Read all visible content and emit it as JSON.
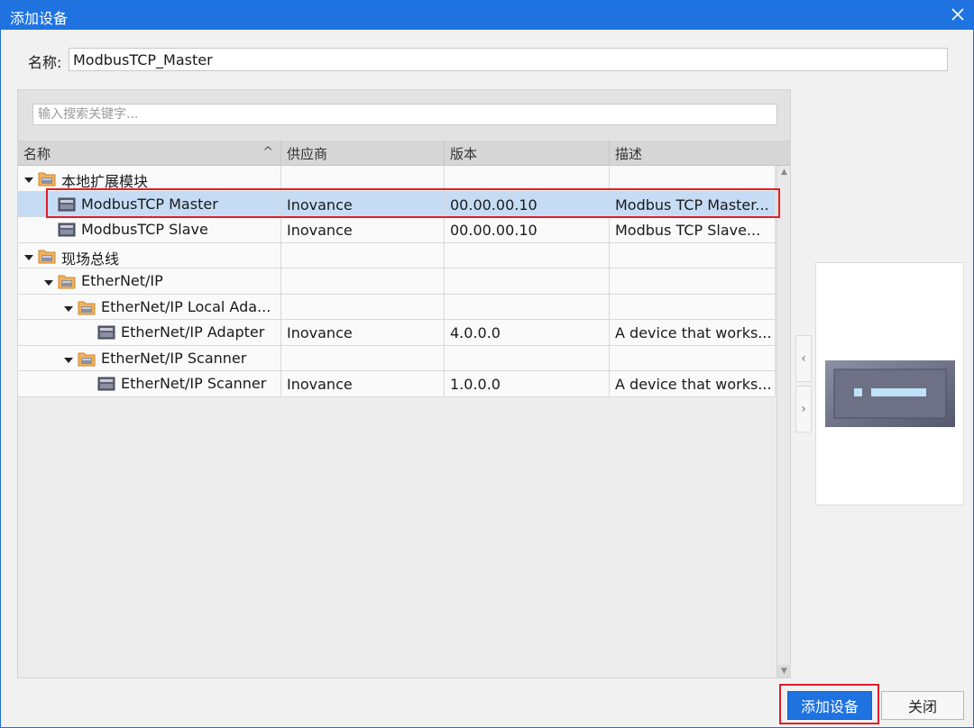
{
  "window": {
    "title": "添加设备"
  },
  "name_field": {
    "label": "名称:",
    "value": "ModbusTCP_Master"
  },
  "search": {
    "placeholder": "输入搜索关键字..."
  },
  "columns": [
    "名称",
    "供应商",
    "版本",
    "描述"
  ],
  "tree": [
    {
      "level": 0,
      "type": "folder",
      "expanded": true,
      "name": "本地扩展模块",
      "vendor": "",
      "version": "",
      "desc": ""
    },
    {
      "level": 1,
      "type": "device",
      "name": "ModbusTCP Master",
      "vendor": "Inovance",
      "version": "00.00.00.10",
      "desc": "Modbus TCP Master...",
      "selected": true
    },
    {
      "level": 1,
      "type": "device",
      "name": "ModbusTCP Slave",
      "vendor": "Inovance",
      "version": "00.00.00.10",
      "desc": "Modbus TCP Slave..."
    },
    {
      "level": 0,
      "type": "folder",
      "expanded": true,
      "name": "现场总线",
      "vendor": "",
      "version": "",
      "desc": ""
    },
    {
      "level": 1,
      "type": "folder",
      "expanded": true,
      "name": "EtherNet/IP",
      "vendor": "",
      "version": "",
      "desc": ""
    },
    {
      "level": 2,
      "type": "folder",
      "expanded": true,
      "name": "EtherNet/IP Local Ada...",
      "vendor": "",
      "version": "",
      "desc": ""
    },
    {
      "level": 3,
      "type": "device",
      "name": "EtherNet/IP Adapter",
      "vendor": "Inovance",
      "version": "4.0.0.0",
      "desc": "A device that works..."
    },
    {
      "level": 2,
      "type": "folder",
      "expanded": true,
      "name": "EtherNet/IP Scanner",
      "vendor": "",
      "version": "",
      "desc": ""
    },
    {
      "level": 3,
      "type": "device",
      "name": "EtherNet/IP Scanner",
      "vendor": "Inovance",
      "version": "1.0.0.0",
      "desc": "A device that works..."
    }
  ],
  "nav": {
    "prev": "‹",
    "next": "›"
  },
  "buttons": {
    "add": "添加设备",
    "close": "关闭"
  },
  "colors": {
    "accent": "#1f73e0",
    "selection": "#c6dcf5",
    "highlight": "#e01e26"
  }
}
